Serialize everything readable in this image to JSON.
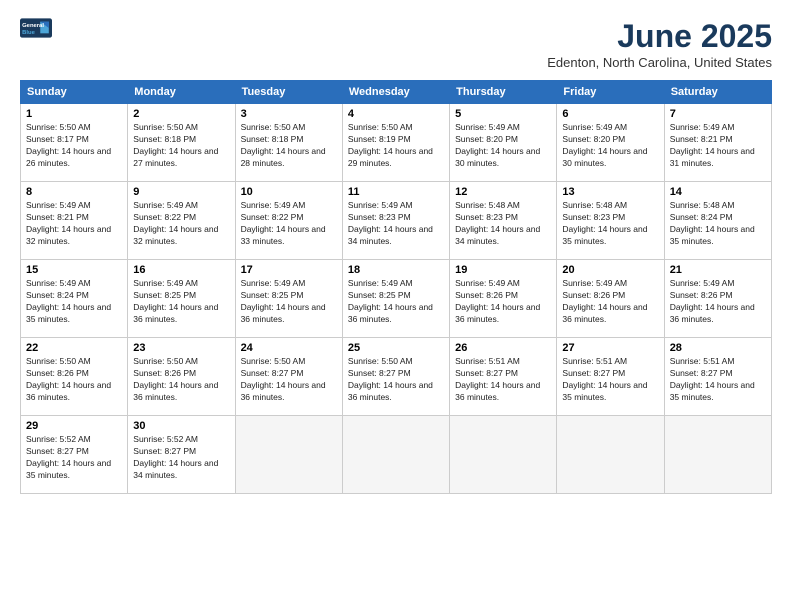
{
  "header": {
    "logo_line1": "General",
    "logo_line2": "Blue",
    "month_title": "June 2025",
    "location": "Edenton, North Carolina, United States"
  },
  "weekdays": [
    "Sunday",
    "Monday",
    "Tuesday",
    "Wednesday",
    "Thursday",
    "Friday",
    "Saturday"
  ],
  "weeks": [
    [
      {
        "day": "1",
        "sunrise": "5:50 AM",
        "sunset": "8:17 PM",
        "daylight": "14 hours and 26 minutes."
      },
      {
        "day": "2",
        "sunrise": "5:50 AM",
        "sunset": "8:18 PM",
        "daylight": "14 hours and 27 minutes."
      },
      {
        "day": "3",
        "sunrise": "5:50 AM",
        "sunset": "8:18 PM",
        "daylight": "14 hours and 28 minutes."
      },
      {
        "day": "4",
        "sunrise": "5:50 AM",
        "sunset": "8:19 PM",
        "daylight": "14 hours and 29 minutes."
      },
      {
        "day": "5",
        "sunrise": "5:49 AM",
        "sunset": "8:20 PM",
        "daylight": "14 hours and 30 minutes."
      },
      {
        "day": "6",
        "sunrise": "5:49 AM",
        "sunset": "8:20 PM",
        "daylight": "14 hours and 30 minutes."
      },
      {
        "day": "7",
        "sunrise": "5:49 AM",
        "sunset": "8:21 PM",
        "daylight": "14 hours and 31 minutes."
      }
    ],
    [
      {
        "day": "8",
        "sunrise": "5:49 AM",
        "sunset": "8:21 PM",
        "daylight": "14 hours and 32 minutes."
      },
      {
        "day": "9",
        "sunrise": "5:49 AM",
        "sunset": "8:22 PM",
        "daylight": "14 hours and 32 minutes."
      },
      {
        "day": "10",
        "sunrise": "5:49 AM",
        "sunset": "8:22 PM",
        "daylight": "14 hours and 33 minutes."
      },
      {
        "day": "11",
        "sunrise": "5:49 AM",
        "sunset": "8:23 PM",
        "daylight": "14 hours and 34 minutes."
      },
      {
        "day": "12",
        "sunrise": "5:48 AM",
        "sunset": "8:23 PM",
        "daylight": "14 hours and 34 minutes."
      },
      {
        "day": "13",
        "sunrise": "5:48 AM",
        "sunset": "8:23 PM",
        "daylight": "14 hours and 35 minutes."
      },
      {
        "day": "14",
        "sunrise": "5:48 AM",
        "sunset": "8:24 PM",
        "daylight": "14 hours and 35 minutes."
      }
    ],
    [
      {
        "day": "15",
        "sunrise": "5:49 AM",
        "sunset": "8:24 PM",
        "daylight": "14 hours and 35 minutes."
      },
      {
        "day": "16",
        "sunrise": "5:49 AM",
        "sunset": "8:25 PM",
        "daylight": "14 hours and 36 minutes."
      },
      {
        "day": "17",
        "sunrise": "5:49 AM",
        "sunset": "8:25 PM",
        "daylight": "14 hours and 36 minutes."
      },
      {
        "day": "18",
        "sunrise": "5:49 AM",
        "sunset": "8:25 PM",
        "daylight": "14 hours and 36 minutes."
      },
      {
        "day": "19",
        "sunrise": "5:49 AM",
        "sunset": "8:26 PM",
        "daylight": "14 hours and 36 minutes."
      },
      {
        "day": "20",
        "sunrise": "5:49 AM",
        "sunset": "8:26 PM",
        "daylight": "14 hours and 36 minutes."
      },
      {
        "day": "21",
        "sunrise": "5:49 AM",
        "sunset": "8:26 PM",
        "daylight": "14 hours and 36 minutes."
      }
    ],
    [
      {
        "day": "22",
        "sunrise": "5:50 AM",
        "sunset": "8:26 PM",
        "daylight": "14 hours and 36 minutes."
      },
      {
        "day": "23",
        "sunrise": "5:50 AM",
        "sunset": "8:26 PM",
        "daylight": "14 hours and 36 minutes."
      },
      {
        "day": "24",
        "sunrise": "5:50 AM",
        "sunset": "8:27 PM",
        "daylight": "14 hours and 36 minutes."
      },
      {
        "day": "25",
        "sunrise": "5:50 AM",
        "sunset": "8:27 PM",
        "daylight": "14 hours and 36 minutes."
      },
      {
        "day": "26",
        "sunrise": "5:51 AM",
        "sunset": "8:27 PM",
        "daylight": "14 hours and 36 minutes."
      },
      {
        "day": "27",
        "sunrise": "5:51 AM",
        "sunset": "8:27 PM",
        "daylight": "14 hours and 35 minutes."
      },
      {
        "day": "28",
        "sunrise": "5:51 AM",
        "sunset": "8:27 PM",
        "daylight": "14 hours and 35 minutes."
      }
    ],
    [
      {
        "day": "29",
        "sunrise": "5:52 AM",
        "sunset": "8:27 PM",
        "daylight": "14 hours and 35 minutes."
      },
      {
        "day": "30",
        "sunrise": "5:52 AM",
        "sunset": "8:27 PM",
        "daylight": "14 hours and 34 minutes."
      },
      null,
      null,
      null,
      null,
      null
    ]
  ]
}
